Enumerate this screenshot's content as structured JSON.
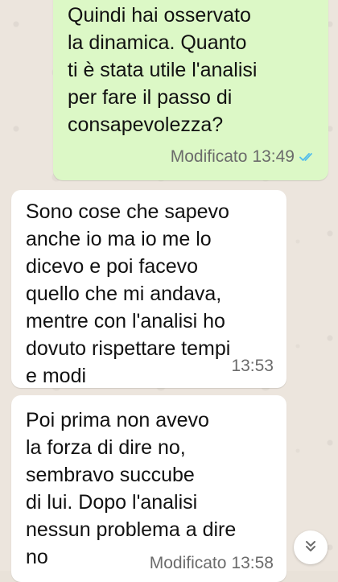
{
  "messages": [
    {
      "text": "Quindi hai osservato\nla dinamica. Quanto\nti è stata utile l'analisi\nper fare il passo di\nconsapevolezza?",
      "status": "Modificato",
      "time": "13:49",
      "direction": "outgoing",
      "read_receipt": "double-check-icon",
      "color": "#dcf8c6"
    },
    {
      "text": "Sono cose che sapevo\nanche io ma io me lo\ndicevo e poi facevo\nquello che mi andava,\nmentre con l'analisi ho\ndovuto rispettare tempi\ne modi",
      "time": "13:53",
      "direction": "incoming",
      "color": "#ffffff"
    },
    {
      "text": "Poi prima non avevo\nla forza di dire no,\nsembravo succube\ndi lui. Dopo l'analisi\nnessun problema a dire\nno",
      "status": "Modificato",
      "time": "13:58",
      "direction": "incoming",
      "color": "#ffffff"
    }
  ],
  "scroll_button": {
    "icon": "double-chevron-down-icon"
  },
  "colors": {
    "tick_read": "#53bdeb",
    "meta_text": "#6b6b6b"
  }
}
